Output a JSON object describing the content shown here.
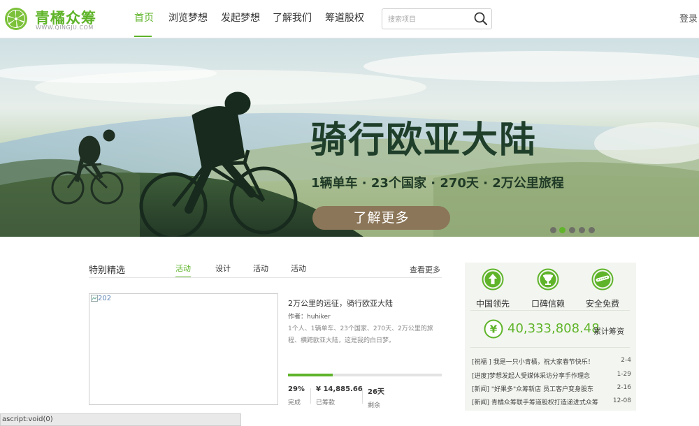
{
  "brand": {
    "name": "青橘众筹",
    "url_text": "WWW.QINGJU.COM",
    "color": "#5fb42a"
  },
  "nav": {
    "items": [
      {
        "label": "首页",
        "active": true
      },
      {
        "label": "浏览梦想",
        "active": false
      },
      {
        "label": "发起梦想",
        "active": false
      },
      {
        "label": "了解我们",
        "active": false
      },
      {
        "label": "筹道股权",
        "active": false
      }
    ]
  },
  "search": {
    "placeholder": "搜索项目",
    "icon": "search-icon"
  },
  "header": {
    "login_label": "登录"
  },
  "banner": {
    "title": "骑行欧亚大陆",
    "subtitle": "1辆单车 · 23个国家 · 270天 · 2万公里旅程",
    "button_label": "了解更多",
    "button_color": "#8b7659",
    "slide_count": 5,
    "active_slide": 2
  },
  "featured": {
    "title": "特别精选",
    "tabs": [
      {
        "label": "活动",
        "active": true
      },
      {
        "label": "设计",
        "active": false
      },
      {
        "label": "活动",
        "active": false
      },
      {
        "label": "活动",
        "active": false
      }
    ],
    "more_label": "查看更多",
    "project": {
      "image_alt": "202",
      "title": "2万公里的远征，骑行欧亚大陆",
      "author": "作者：huhiker",
      "description": "1个人、1辆单车、23个国家、270天、2万公里的旅程、横跨欧亚大陆，这是我的白日梦。",
      "progress_percent": 29,
      "stats": [
        {
          "value": "29%",
          "label": "完成"
        },
        {
          "value": "¥ 14,885.66",
          "label": "已筹款"
        },
        {
          "value": "26天",
          "label": "剩余"
        }
      ]
    }
  },
  "side": {
    "features": [
      {
        "label": "中国领先",
        "icon": "arrow-up-icon"
      },
      {
        "label": "口碑信赖",
        "icon": "trophy-icon"
      },
      {
        "label": "安全免费",
        "icon": "free-badge-icon"
      }
    ],
    "total_amount": "40,333,808.48",
    "total_label": "累计筹资",
    "yen_icon": "yen-icon",
    "news": [
      {
        "text": "[祝福 ] 我是一只小青橘，祝大家春节快乐！",
        "date": "2-4"
      },
      {
        "text": "[进度]梦想发起人受媒体采访分享手作理念",
        "date": "1-29"
      },
      {
        "text": "[新闻] \"好果多\"众筹新店 员工客户变身股东",
        "date": "2-16"
      },
      {
        "text": "[新闻] 青橘众筹联手筹道股权打造递进式众筹",
        "date": "12-08"
      }
    ]
  },
  "statusbar": {
    "text": "ascript:void(0)"
  }
}
